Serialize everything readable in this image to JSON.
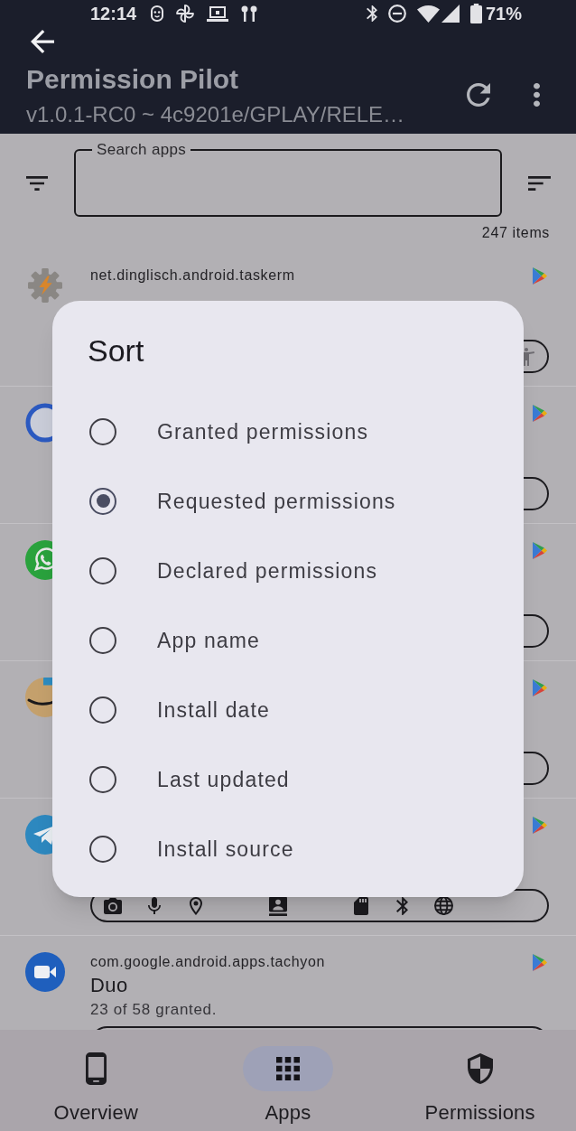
{
  "status_bar": {
    "time": "12:14",
    "battery": "71%"
  },
  "app_bar": {
    "title": "Permission Pilot",
    "subtitle": "v1.0.1-RC0 ~ 4c9201e/GPLAY/RELE…"
  },
  "search": {
    "label": "Search apps"
  },
  "item_count": "247 items",
  "apps": [
    {
      "kind": "gear",
      "package": "net.dinglisch.android.taskerm",
      "permissions": [
        {
          "kind": "accessibility"
        }
      ]
    },
    {
      "kind": "ring"
    },
    {
      "kind": "chat-bubble"
    },
    {
      "kind": "smile"
    },
    {
      "kind": "paper-plane",
      "permissions": [
        {
          "kind": "camera"
        },
        {
          "kind": "microphone"
        },
        {
          "kind": "location"
        },
        {
          "kind": "contacts"
        },
        {
          "kind": "storage"
        },
        {
          "kind": "nearby"
        },
        {
          "kind": "network"
        }
      ]
    },
    {
      "kind": "video",
      "package": "com.google.android.apps.tachyon",
      "name": "Duo",
      "summary": "23 of 58 granted."
    }
  ],
  "sort_dialog": {
    "title": "Sort",
    "options": [
      {
        "label": "Granted permissions",
        "selected": false
      },
      {
        "label": "Requested permissions",
        "selected": true
      },
      {
        "label": "Declared permissions",
        "selected": false
      },
      {
        "label": "App name",
        "selected": false
      },
      {
        "label": "Install date",
        "selected": false
      },
      {
        "label": "Last updated",
        "selected": false
      },
      {
        "label": "Install source",
        "selected": false
      }
    ]
  },
  "nav": [
    {
      "kind": "phone",
      "label": "Overview",
      "selected": false
    },
    {
      "kind": "grid",
      "label": "Apps",
      "selected": true
    },
    {
      "kind": "shield",
      "label": "Permissions",
      "selected": false
    }
  ]
}
